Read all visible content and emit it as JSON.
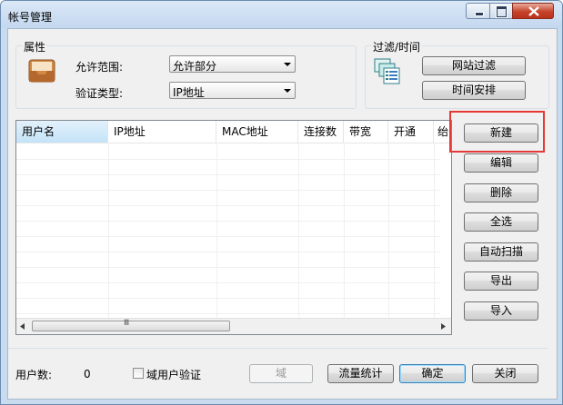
{
  "window": {
    "title": "帐号管理"
  },
  "properties": {
    "group_title": "属性",
    "allow_scope_label": "允许范围:",
    "allow_scope_value": "允许部分",
    "auth_type_label": "验证类型:",
    "auth_type_value": "IP地址"
  },
  "filter_time": {
    "group_title": "过滤/时间",
    "site_filter_label": "网站过滤",
    "time_schedule_label": "时间安排"
  },
  "table": {
    "columns": [
      "用户名",
      "IP地址",
      "MAC地址",
      "连接数",
      "带宽",
      "开通",
      "绐"
    ],
    "rows": [],
    "scroll_thumb_text": "Ⅲ"
  },
  "actions": {
    "new_label": "新建",
    "edit_label": "编辑",
    "delete_label": "删除",
    "select_all_label": "全选",
    "auto_scan_label": "自动扫描",
    "export_label": "导出",
    "import_label": "导入"
  },
  "footer": {
    "user_count_label": "用户数:",
    "user_count_value": "0",
    "domain_auth_label": "域用户验证",
    "domain_label": "域",
    "traffic_stats_label": "流量统计",
    "ok_label": "确定",
    "close_label": "关闭"
  },
  "colors": {
    "highlight": "#e53935",
    "accent": "#3c7fb1"
  }
}
